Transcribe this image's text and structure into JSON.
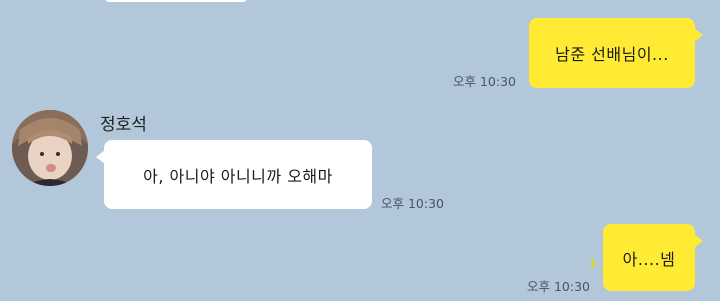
{
  "messages": [
    {
      "id": "msg-1",
      "from": "me",
      "text": "남준 선배님이...",
      "time": "오후 10:30"
    },
    {
      "id": "msg-2",
      "from": "them",
      "sender": "정호석",
      "text": "아, 아니야 아니니까 오해마",
      "time": "오후 10:30"
    },
    {
      "id": "msg-3",
      "from": "me",
      "text": "아....넴",
      "time": "오후 10:30",
      "unread": "1"
    }
  ],
  "colors": {
    "background": "#b2c7da",
    "my_bubble": "#ffeb33",
    "their_bubble": "#ffffff",
    "unread": "#e8d61a"
  }
}
